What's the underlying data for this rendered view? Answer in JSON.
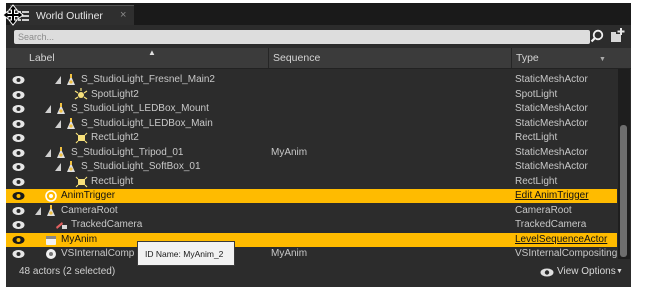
{
  "tab": {
    "title": "World Outliner",
    "close": "×"
  },
  "search": {
    "placeholder": "Search..."
  },
  "columns": {
    "label": "Label",
    "sequence": "Sequence",
    "type": "Type"
  },
  "rows": [
    {
      "label": "S_StudioLight_Fresnel_Main2",
      "sequence": "",
      "type": "StaticMeshActor",
      "depth": 2,
      "expanded": true,
      "icon": "mesh-actor-icon",
      "selected": false
    },
    {
      "label": "SpotLight2",
      "sequence": "",
      "type": "SpotLight",
      "depth": 3,
      "expanded": false,
      "icon": "spot-light-icon",
      "selected": false
    },
    {
      "label": "S_StudioLight_LEDBox_Mount",
      "sequence": "",
      "type": "StaticMeshActor",
      "depth": 1,
      "expanded": true,
      "icon": "mesh-actor-icon",
      "selected": false
    },
    {
      "label": "S_StudioLight_LEDBox_Main",
      "sequence": "",
      "type": "StaticMeshActor",
      "depth": 2,
      "expanded": true,
      "icon": "mesh-actor-icon",
      "selected": false
    },
    {
      "label": "RectLight2",
      "sequence": "",
      "type": "RectLight",
      "depth": 3,
      "expanded": false,
      "icon": "rect-light-icon",
      "selected": false
    },
    {
      "label": "S_StudioLight_Tripod_01",
      "sequence": "MyAnim",
      "type": "StaticMeshActor",
      "depth": 1,
      "expanded": true,
      "icon": "mesh-actor-icon",
      "selected": false
    },
    {
      "label": "S_StudioLight_SoftBox_01",
      "sequence": "",
      "type": "StaticMeshActor",
      "depth": 2,
      "expanded": true,
      "icon": "mesh-actor-icon",
      "selected": false
    },
    {
      "label": "RectLight",
      "sequence": "",
      "type": "RectLight",
      "depth": 3,
      "expanded": false,
      "icon": "rect-light-icon",
      "selected": false
    },
    {
      "label": "AnimTrigger",
      "sequence": "",
      "type": "Edit AnimTrigger",
      "depth": 0,
      "expanded": false,
      "icon": "trigger-icon",
      "selected": true
    },
    {
      "label": "CameraRoot",
      "sequence": "",
      "type": "CameraRoot",
      "depth": 0,
      "expanded": true,
      "icon": "mesh-actor-icon",
      "selected": false
    },
    {
      "label": "TrackedCamera",
      "sequence": "",
      "type": "TrackedCamera",
      "depth": 1,
      "expanded": false,
      "icon": "camera-icon",
      "selected": false
    },
    {
      "label": "MyAnim",
      "sequence": "",
      "type": "LevelSequenceActor",
      "depth": 0,
      "expanded": false,
      "icon": "level-sequence-icon",
      "selected": true
    },
    {
      "label": "VSInternalComp",
      "sequence": "MyAnim",
      "type": "VSInternalCompositing",
      "depth": 0,
      "expanded": false,
      "icon": "compositing-icon",
      "selected": false
    }
  ],
  "footer": {
    "count": "48 actors (2 selected)",
    "view_options": "View Options"
  },
  "tooltip": {
    "text": "ID Name: MyAnim_2"
  },
  "colors": {
    "selection": "#ffbb00",
    "panel": "#2c2c2c",
    "header": "#3b3b3b"
  }
}
